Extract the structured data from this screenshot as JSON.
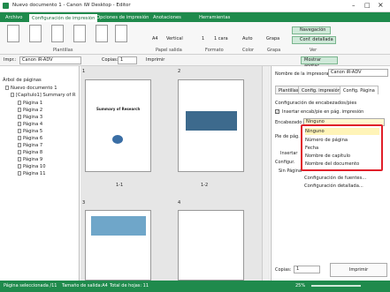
{
  "window": {
    "title": "Nuevo documento 1 - Canon iW Desktop - Editor"
  },
  "ribbon_tabs": [
    "Archivo",
    "Configuración de impresión",
    "Opciones de impresión",
    "Anotaciones",
    "Herramientas"
  ],
  "ribbon": {
    "groups": [
      "Plantillas",
      "Papel salida",
      "Formato",
      "Color",
      "Grapa",
      "Ver"
    ],
    "paper": {
      "label": "A4",
      "orientation": "Vertical"
    },
    "format": {
      "pages": "1",
      "side": "1 cara"
    },
    "color": {
      "label": "Auto"
    },
    "staple": {
      "label": "Grapa"
    },
    "view": {
      "nav": "Navegación",
      "detail": "Conf. detallada"
    }
  },
  "toolbar": {
    "printer_label": "Impr.:",
    "printer_value": "Canon iR-ADV",
    "copies_label": "Copias:",
    "copies_value": "1",
    "print_label": "Imprimir",
    "show_annot": "Mostrar anotac."
  },
  "tree": {
    "header": "Árbol de páginas",
    "root": "Nuevo documento 1",
    "chapter": "[Capítulo1] Summary of R",
    "pages": [
      "Página 1",
      "Página 2",
      "Página 3",
      "Página 4",
      "Página 5",
      "Página 6",
      "Página 7",
      "Página 8",
      "Página 9",
      "Página 10",
      "Página 11"
    ]
  },
  "center": {
    "page_labels": [
      "1",
      "2",
      "3",
      "4"
    ],
    "spread_labels": [
      "1-1",
      "1-2"
    ],
    "page1_title": "Summary of Research"
  },
  "right_panel": {
    "printer_name_label": "Nombre de la impresora:",
    "printer_name_value": "Canon iR-ADV",
    "tabs": [
      "Plantillas",
      "Config. impresión",
      "Config. Página"
    ],
    "header_section": "Configuración de encabezados/pies",
    "insert_check": "Insertar encab/pie en pág. impresión",
    "header_label": "Encabezado:",
    "header_value": "Ninguno",
    "footer_label": "Pie de pág.",
    "insert2": "Insertar",
    "config_label": "Configur.",
    "no_page": "Sin Página",
    "copies_label": "Copias:",
    "copies_value": "1",
    "print_btn": "Imprimir"
  },
  "dropdown": {
    "options": [
      "Ninguno",
      "Número de página",
      "Fecha",
      "Nombre de capítulo",
      "Nombre del documento"
    ],
    "extra": [
      "Configuración de fuentes...",
      "Configuración detallada..."
    ]
  },
  "status": {
    "selected": "Página seleccionada /11",
    "size": "Tamaño de salida:A4",
    "total": "Total de hojas: 11",
    "zoom": "25%"
  }
}
